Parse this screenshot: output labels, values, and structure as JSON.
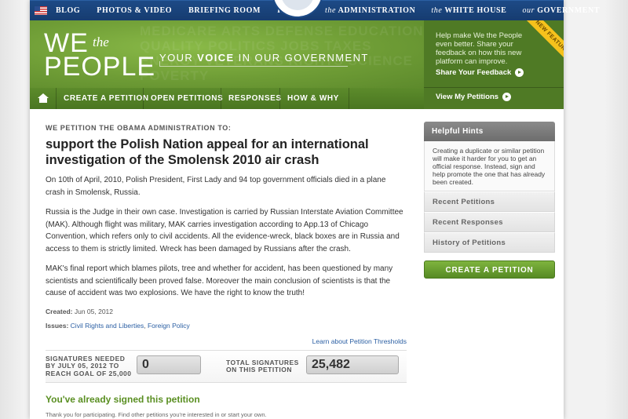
{
  "topnav": {
    "left_items": [
      "BLOG",
      "PHOTOS & VIDEO",
      "BRIEFING ROOM",
      "ISSUES"
    ],
    "right_items": [
      {
        "prefix": "the",
        "label": "ADMINISTRATION"
      },
      {
        "prefix": "the",
        "label": "WHITE HOUSE"
      },
      {
        "prefix": "our",
        "label": "GOVERNMENT"
      }
    ]
  },
  "hero": {
    "logo_we": "WE",
    "logo_the": "the",
    "logo_people": "PEOPLE",
    "tagline_pre": "YOUR ",
    "tagline_bold": "VOICE",
    "tagline_post": " IN OUR GOVERNMENT",
    "background_words": "MEDICARE ARTS DEFENSE EDUCATION QUALITY POLITICS JOBS TAXES ENERGY VETERANS RIGHTS SCIENCE POVERTY"
  },
  "feedback": {
    "text": "Help make We the People even better. Share your feedback on how this new platform can improve.",
    "share_link": "Share Your Feedback",
    "ribbon": "NEW FEATURE",
    "my_petitions_link": "View My Petitions"
  },
  "greennav": {
    "items": [
      "CREATE A PETITION",
      "OPEN PETITIONS",
      "RESPONSES",
      "HOW & WHY"
    ]
  },
  "petition": {
    "lead": "WE PETITION THE OBAMA ADMINISTRATION TO:",
    "title": "support the Polish Nation appeal for an international investigation of the Smolensk 2010 air crash",
    "paragraphs": [
      "On 10th of April, 2010, Polish President, First Lady and 94 top government officials died in a plane crash in Smolensk, Russia.",
      "Russia is the Judge in their own case. Investigation is carried by Russian Interstate Aviation Committee (MAK). Although flight was military, MAK carries investigation according to App.13 of Chicago Convention, which refers only to civil accidents. All the evidence-wreck, black boxes are in Russia and access to them is strictly limited. Wreck has been damaged by Russians after the crash.",
      "MAK's final report which blames pilots, tree and whether for accident, has been questioned by many scientists and scientifically been proved false. Moreover the main conclusion of scientists is that the cause of accident was two explosions. We have the right to know the truth!"
    ],
    "created_label": "Created:",
    "created_value": "Jun 05, 2012",
    "issues_label": "Issues:",
    "issues": [
      "Civil Rights and Liberties",
      "Foreign Policy"
    ],
    "threshold_link": "Learn about Petition Thresholds",
    "needed_label": "SIGNATURES NEEDED BY JULY 05, 2012 TO REACH GOAL OF 25,000",
    "needed_value": "0",
    "total_label": "TOTAL SIGNATURES ON THIS PETITION",
    "total_value": "25,482",
    "signed_title": "You've already signed this petition",
    "signed_note": "Thank you for participating. Find other petitions you're interested in or start your own."
  },
  "sidebar": {
    "hints_title": "Helpful Hints",
    "hints_text": "Creating a duplicate or similar petition will make it harder for you to get an official response. Instead, sign and help promote the one that has already been created.",
    "items": [
      "Recent Petitions",
      "Recent Responses",
      "History of Petitions"
    ],
    "create_button": "CREATE A PETITION"
  },
  "colors": {
    "nav_blue": "#1d4a86",
    "hero_green": "#6f9d36",
    "signed_green": "#5a8f22",
    "link_blue": "#2b5fa3"
  }
}
